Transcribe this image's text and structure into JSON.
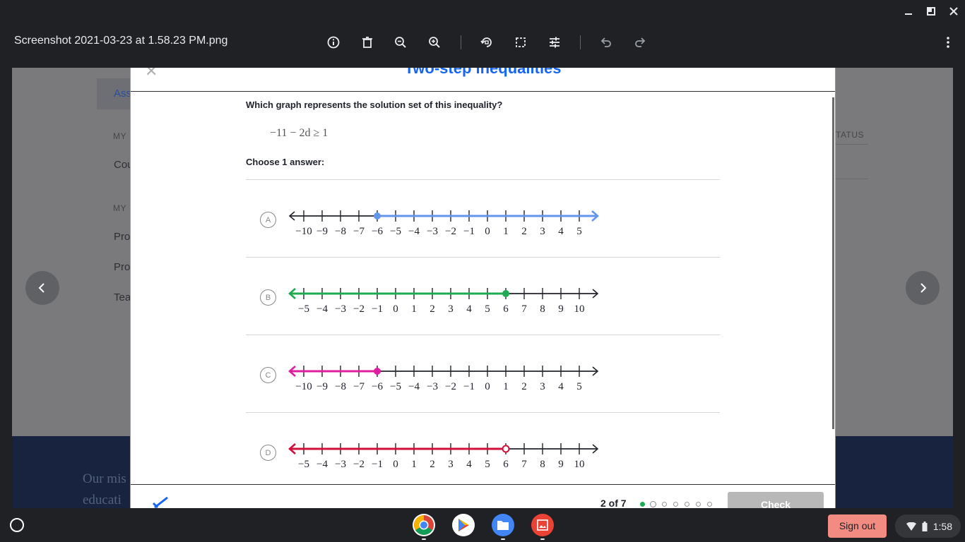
{
  "window": {
    "minimize_icon": "minimize-icon",
    "maximize_icon": "maximize-icon",
    "close_icon": "close-icon"
  },
  "viewer": {
    "file_title": "Screenshot 2021-03-23 at 1.58.23 PM.png",
    "tools": [
      "info-icon",
      "delete-icon",
      "zoom-out-icon",
      "zoom-in-icon",
      "rotate-icon",
      "crop-icon",
      "adjust-icon",
      "undo-icon",
      "redo-icon",
      "more-icon"
    ]
  },
  "background_page": {
    "tab_fragment": "Ass",
    "section1_fragment": "MY",
    "row1_fragment": "Cou",
    "section2_fragment": "MY",
    "items": [
      "Pro",
      "Pro",
      "Tea"
    ],
    "status_fragment": "TATUS",
    "footer_line1": "Our mis",
    "footer_line2": "educati"
  },
  "modal": {
    "title": "Two-step inequalities",
    "question": "Which graph represents the solution set of this inequality?",
    "inequality": "−11 − 2d ≥ 1",
    "choose_label": "Choose 1 answer:",
    "choices": [
      {
        "letter": "A",
        "labels": [
          "−10",
          "−9",
          "−8",
          "−7",
          "−6",
          "−5",
          "−4",
          "−3",
          "−2",
          "−1",
          "0",
          "1",
          "2",
          "3",
          "4",
          "5"
        ],
        "point": "−6",
        "point_type": "closed",
        "direction": "right",
        "color": "#6495ed"
      },
      {
        "letter": "B",
        "labels": [
          "−5",
          "−4",
          "−3",
          "−2",
          "−1",
          "0",
          "1",
          "2",
          "3",
          "4",
          "5",
          "6",
          "7",
          "8",
          "9",
          "10"
        ],
        "point": "6",
        "point_type": "closed",
        "direction": "left",
        "color": "#1fab54"
      },
      {
        "letter": "C",
        "labels": [
          "−10",
          "−9",
          "−8",
          "−7",
          "−6",
          "−5",
          "−4",
          "−3",
          "−2",
          "−1",
          "0",
          "1",
          "2",
          "3",
          "4",
          "5"
        ],
        "point": "−6",
        "point_type": "closed",
        "direction": "left",
        "color": "#e01fa0"
      },
      {
        "letter": "D",
        "labels": [
          "−5",
          "−4",
          "−3",
          "−2",
          "−1",
          "0",
          "1",
          "2",
          "3",
          "4",
          "5",
          "6",
          "7",
          "8",
          "9",
          "10"
        ],
        "point": "6",
        "point_type": "open",
        "direction": "left",
        "color": "#d0103a"
      }
    ],
    "progress": "2 of 7",
    "check_label": "Check",
    "close_icon": "close-icon"
  },
  "shelf": {
    "apps": [
      "chrome-icon",
      "play-store-icon",
      "files-icon",
      "gallery-icon"
    ],
    "signout_label": "Sign out",
    "time": "1:58"
  }
}
